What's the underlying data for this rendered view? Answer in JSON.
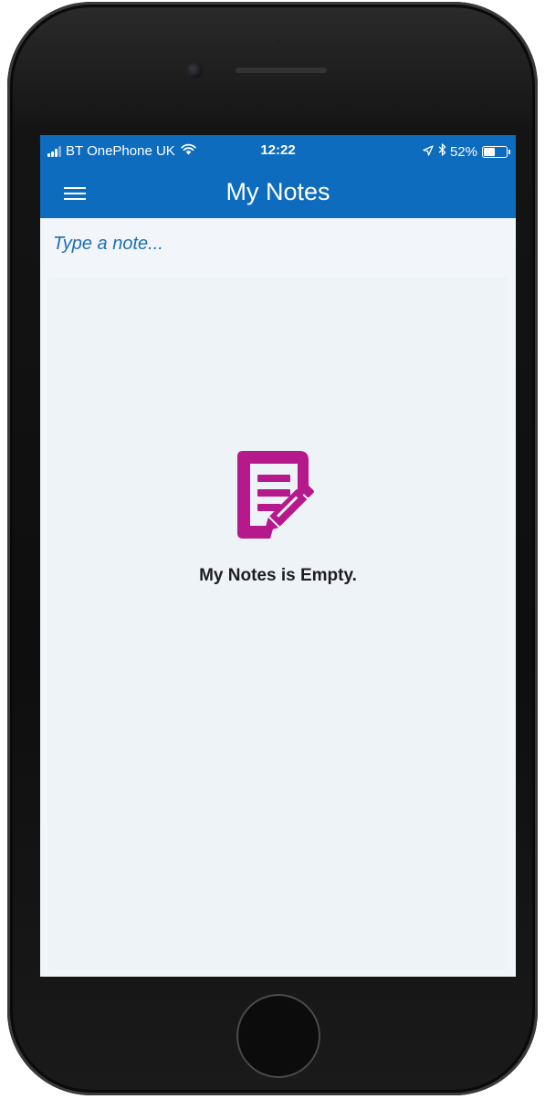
{
  "status_bar": {
    "carrier": "BT OnePhone UK",
    "time": "12:22",
    "battery_text": "52%",
    "battery_level": 0.52,
    "icons": [
      "signal-icon",
      "wifi-icon",
      "location-arrow-icon",
      "bluetooth-icon",
      "battery-icon"
    ]
  },
  "header": {
    "title": "My Notes",
    "menu_icon": "hamburger-menu-icon"
  },
  "note_input": {
    "placeholder": "Type a note..."
  },
  "empty_state": {
    "icon": "note-edit-icon",
    "message": "My Notes is Empty."
  },
  "colors": {
    "header_background": "#0e6cbf",
    "accent_text": "#1f6fb5",
    "empty_icon": "#b5198c",
    "screen_background": "#f2f6fa"
  }
}
